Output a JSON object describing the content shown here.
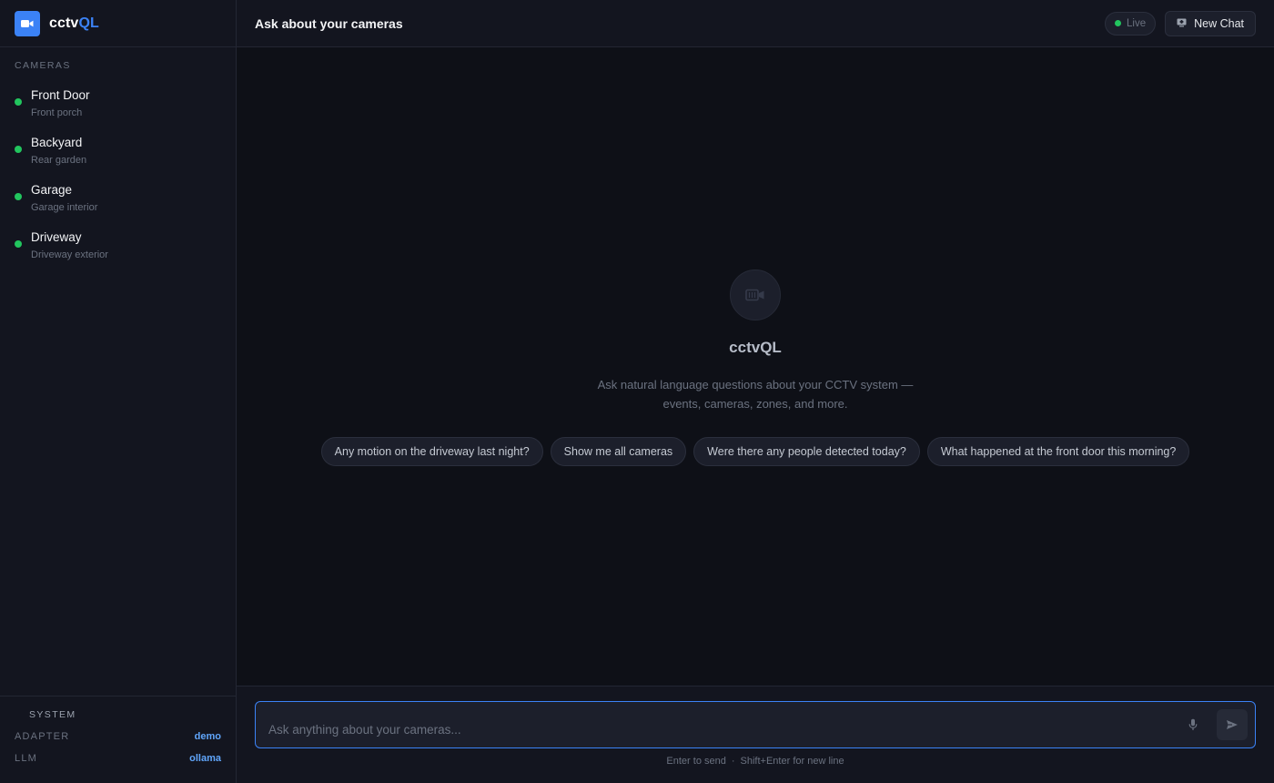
{
  "brand": {
    "name_prefix": "cctv",
    "name_suffix": "QL",
    "logo_icon": "video-camera-icon"
  },
  "sidebar": {
    "cameras_label": "CAMERAS",
    "cameras": [
      {
        "name": "Front Door",
        "location": "Front porch",
        "status": "online"
      },
      {
        "name": "Backyard",
        "location": "Rear garden",
        "status": "online"
      },
      {
        "name": "Garage",
        "location": "Garage interior",
        "status": "online"
      },
      {
        "name": "Driveway",
        "location": "Driveway exterior",
        "status": "online"
      }
    ],
    "system": {
      "label": "SYSTEM",
      "adapter_key": "ADAPTER",
      "adapter_value": "demo",
      "llm_key": "LLM",
      "llm_value": "ollama"
    }
  },
  "header": {
    "title": "Ask about your cameras",
    "live_label": "Live",
    "new_chat_label": "New Chat"
  },
  "hero": {
    "title": "cctvQL",
    "description": "Ask natural language questions about your CCTV system — events, cameras, zones, and more."
  },
  "suggestions": [
    "Any motion on the driveway last night?",
    "Show me all cameras",
    "Were there any people detected today?",
    "What happened at the front door this morning?"
  ],
  "composer": {
    "placeholder": "Ask anything about your cameras...",
    "value": "",
    "hint_send": "Enter to send",
    "hint_separator": "·",
    "hint_newline": "Shift+Enter for new line"
  },
  "colors": {
    "accent": "#3b82f6",
    "status_online": "#22c55e",
    "background": "#0e1017",
    "panel": "#13151f"
  }
}
